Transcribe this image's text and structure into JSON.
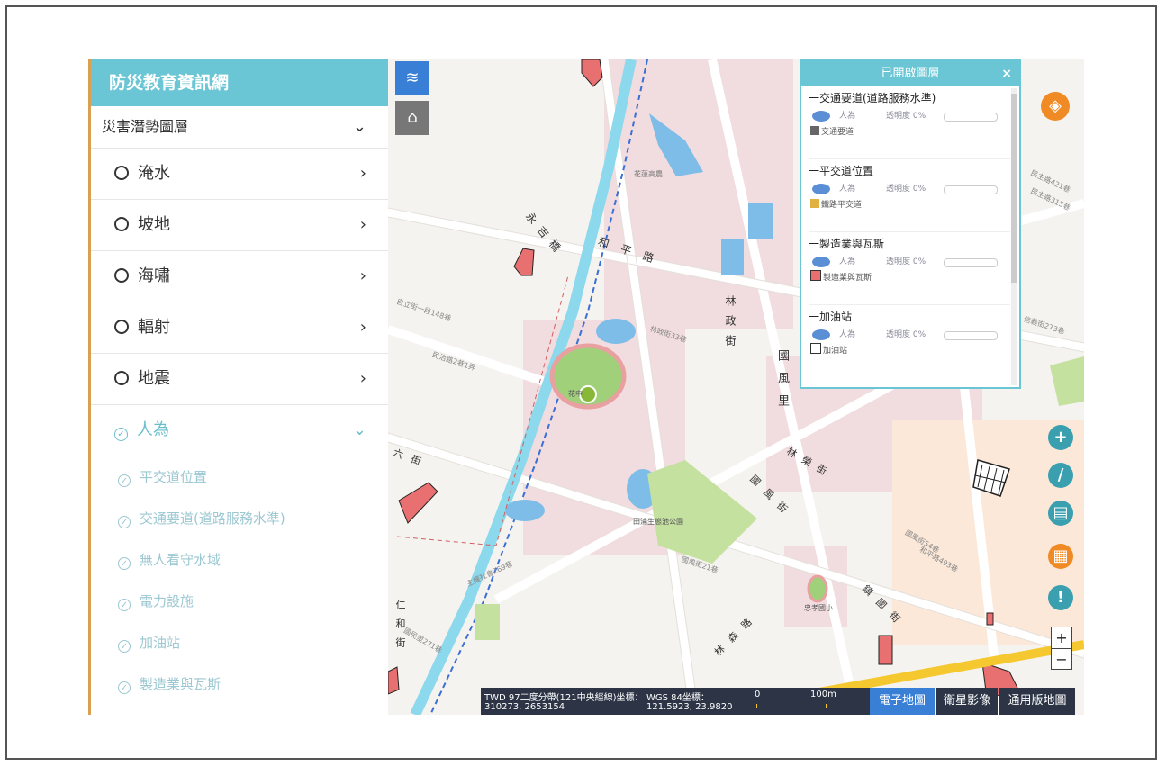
{
  "sidebar": {
    "title": "防災教育資訊網",
    "category": "災害潛勢圖層",
    "items": [
      {
        "label": "淹水"
      },
      {
        "label": "坡地"
      },
      {
        "label": "海嘯"
      },
      {
        "label": "輻射"
      },
      {
        "label": "地震"
      }
    ],
    "active_item": "人為",
    "sub_items": [
      {
        "label": "平交道位置"
      },
      {
        "label": "交通要道(道路服務水準)"
      },
      {
        "label": "無人看守水域"
      },
      {
        "label": "電力設施"
      },
      {
        "label": "加油站"
      },
      {
        "label": "製造業與瓦斯"
      }
    ]
  },
  "layer_panel": {
    "title": "已開啟圖層",
    "layers": [
      {
        "title": "一交通要道(道路服務水準)",
        "visibility": "人為",
        "opacity": "透明度 0%",
        "legend": "交通要道",
        "legend_color": "#666666"
      },
      {
        "title": "一平交道位置",
        "visibility": "人為",
        "opacity": "透明度 0%",
        "legend": "鐵路平交道",
        "legend_color": "#e0b040"
      },
      {
        "title": "一製造業與瓦斯",
        "visibility": "人為",
        "opacity": "透明度 0%",
        "legend": "製造業與瓦斯",
        "legend_color": "#e87070"
      },
      {
        "title": "一加油站",
        "visibility": "人為",
        "opacity": "透明度 0%",
        "legend": "加油站",
        "legend_color": "#333333"
      }
    ]
  },
  "map_labels": {
    "road1": "永吉橋",
    "road2": "和平路",
    "road3": "林政街",
    "road4": "國風里",
    "road5": "林榮街",
    "road6": "國風街",
    "road7": "林森路",
    "road8": "鎮國街",
    "road9": "六街",
    "road10": "仁和街",
    "poi1": "花蓮高農",
    "poi2": "花中",
    "poi3": "田浦生態池公園",
    "poi4": "忠孝國小",
    "alley1": "自立街一段148巷",
    "alley2": "民治路2巷1弄",
    "alley3": "林政街33巷",
    "alley4": "國風街21巷",
    "alley5": "民主路421巷",
    "alley6": "民主路315巷",
    "alley7": "國風街54巷",
    "alley8": "和平路493巷",
    "alley9": "信義街273巷",
    "alley10": "主權社會269巷",
    "alley11": "國民里271巷"
  },
  "coords": {
    "twd_label": "TWD 97二度分帶(121中央經線)坐標：",
    "twd_value": "310273, 2653154",
    "wgs_label": "WGS 84坐標：",
    "wgs_value": "121.5923, 23.9820",
    "scale_start": "0",
    "scale_end": "100m"
  },
  "basemap_buttons": {
    "electronic": "電子地圖",
    "satellite": "衛星影像",
    "general": "通用版地圖"
  },
  "colors": {
    "accent": "#6ac5d4",
    "tool_blue": "#3a7fd6",
    "orange": "#f08a24",
    "teal": "#3aa0b0",
    "dark": "#2c3445"
  }
}
